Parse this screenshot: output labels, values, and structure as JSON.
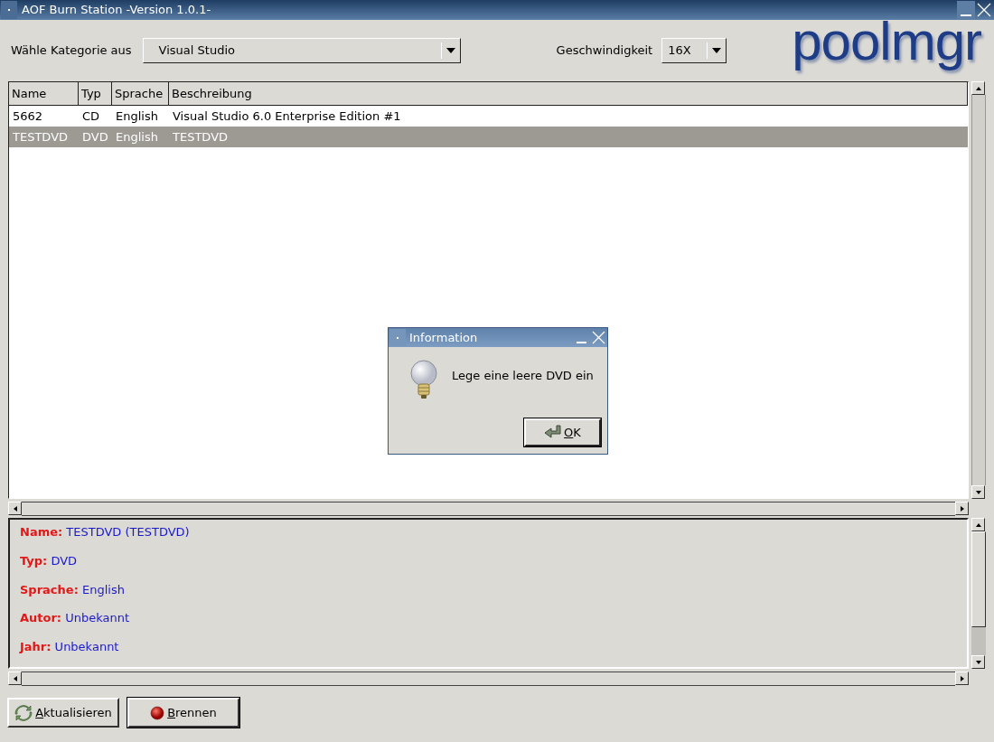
{
  "window": {
    "title": "AOF Burn Station -Version 1.0.1-"
  },
  "category": {
    "label": "Wähle Kategorie aus",
    "value": "Visual Studio"
  },
  "speed": {
    "label": "Geschwindigkeit",
    "value": "16X"
  },
  "logo": "poolmgr",
  "table": {
    "columns": [
      "Name",
      "Typ",
      "Sprache",
      "Beschreibung"
    ],
    "rows": [
      {
        "cells": [
          "5662",
          "CD",
          "English",
          "Visual Studio 6.0 Enterprise Edition #1"
        ],
        "selected": false
      },
      {
        "cells": [
          "TESTDVD",
          "DVD",
          "English",
          "TESTDVD"
        ],
        "selected": true
      }
    ]
  },
  "details": [
    "**Name:** TESTDVD (TESTDVD)",
    "**Typ:** DVD",
    "**Sprache:** English",
    "**Autor:** Unbekannt",
    "**Jahr:** Unbekannt"
  ],
  "buttons": [
    {
      "kind": "refresh",
      "label": "Aktualisieren"
    },
    {
      "kind": "burn",
      "label": "Brennen"
    }
  ],
  "dialog": {
    "title": "Information",
    "message": "Lege eine leere DVD ein",
    "button": "OK"
  }
}
